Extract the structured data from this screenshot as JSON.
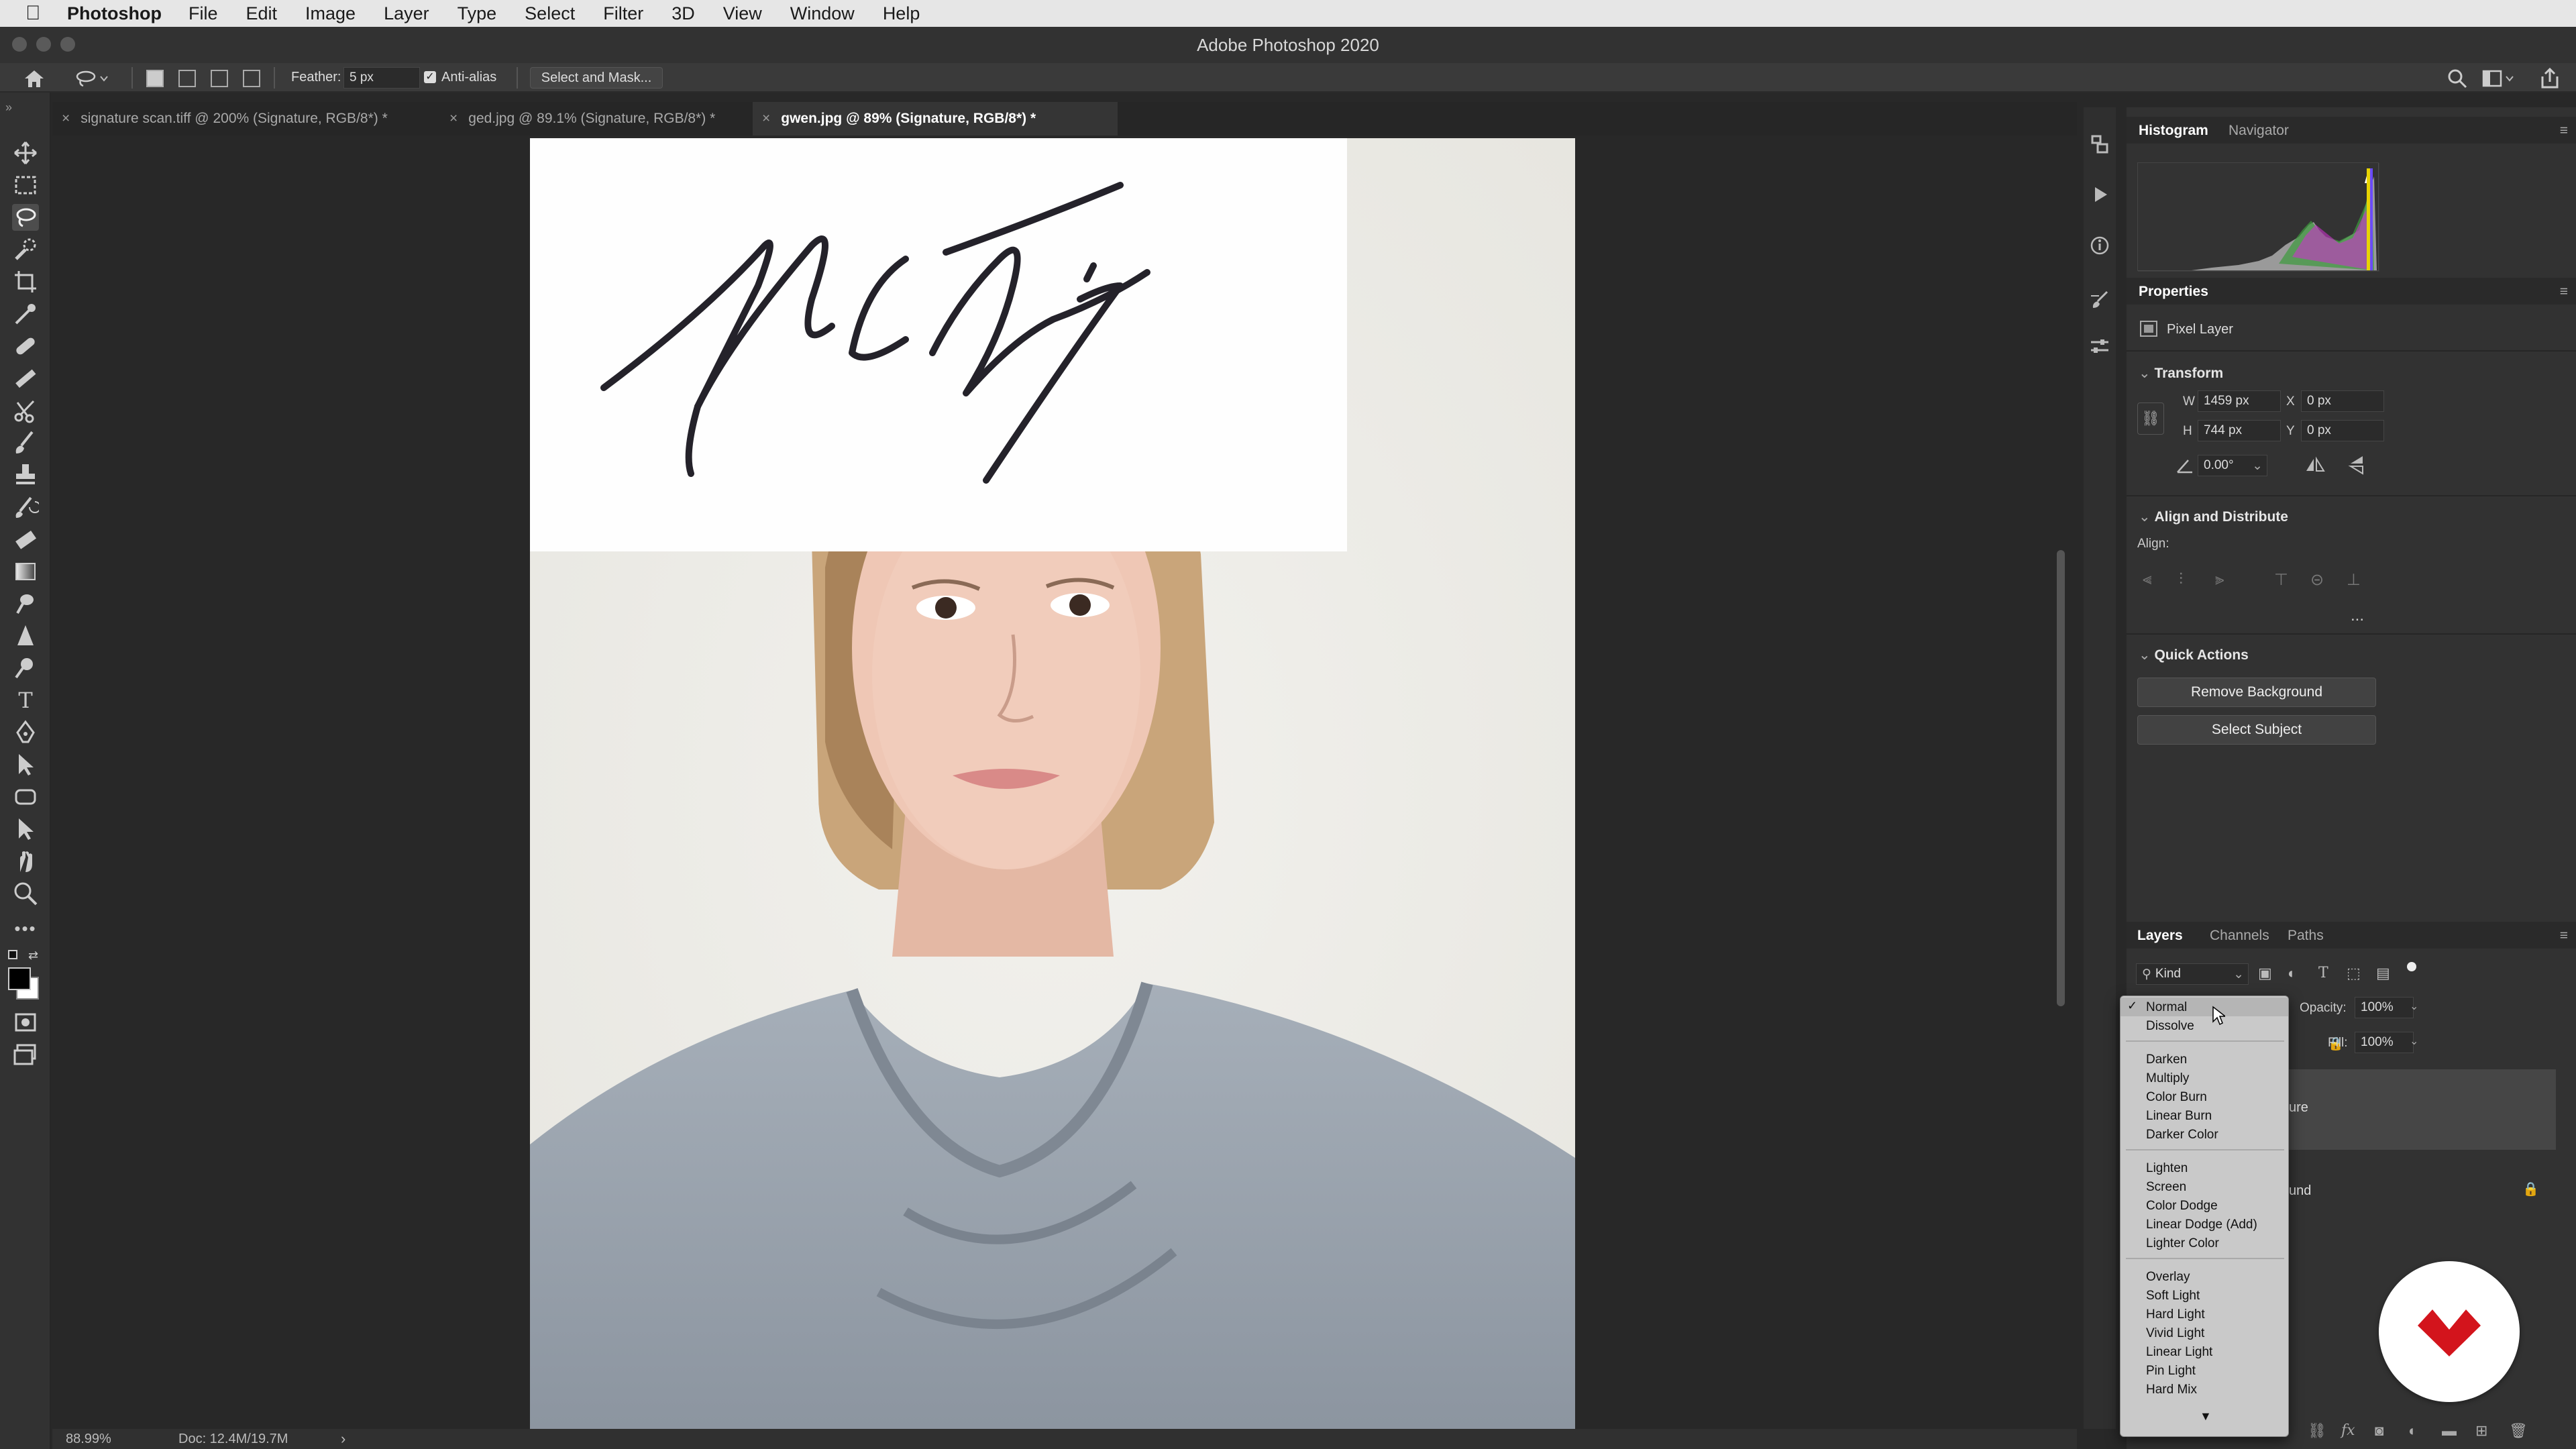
{
  "menubar": {
    "app_name": "Photoshop",
    "menus": [
      "File",
      "Edit",
      "Image",
      "Layer",
      "Type",
      "Select",
      "Filter",
      "3D",
      "View",
      "Window",
      "Help"
    ]
  },
  "window": {
    "title": "Adobe Photoshop 2020"
  },
  "options": {
    "feather_label": "Feather:",
    "feather_value": "5 px",
    "antialias_label": "Anti-alias",
    "select_mask_label": "Select and Mask..."
  },
  "tabs": [
    {
      "label": "signature scan.tiff @ 200% (Signature, RGB/8*) *",
      "active": false
    },
    {
      "label": "ged.jpg @ 89.1% (Signature, RGB/8*) *",
      "active": false
    },
    {
      "label": "gwen.jpg @ 89% (Signature, RGB/8*) *",
      "active": true
    }
  ],
  "status": {
    "zoom": "88.99%",
    "doc": "Doc: 12.4M/19.7M"
  },
  "histogram_panel": {
    "tabs": [
      "Histogram",
      "Navigator"
    ]
  },
  "properties_panel": {
    "title": "Properties",
    "layer_type": "Pixel Layer",
    "transform_title": "Transform",
    "w_label": "W",
    "w_value": "1459 px",
    "h_label": "H",
    "h_value": "744 px",
    "x_label": "X",
    "x_value": "0 px",
    "y_label": "Y",
    "y_value": "0 px",
    "angle_value": "0.00°",
    "align_title": "Align and Distribute",
    "align_label": "Align:",
    "more": "...",
    "quick_actions_title": "Quick Actions",
    "remove_bg": "Remove Background",
    "select_subject": "Select Subject"
  },
  "layers_panel": {
    "tabs": [
      "Layers",
      "Channels",
      "Paths"
    ],
    "filter_label": "Kind",
    "opacity_label": "Opacity:",
    "opacity_value": "100%",
    "fill_label": "Fill:",
    "fill_value": "100%",
    "layer1_partial": "ure",
    "layer2_partial": "und"
  },
  "blend_menu": {
    "checked": "Normal",
    "groups": [
      [
        "Normal",
        "Dissolve"
      ],
      [
        "Darken",
        "Multiply",
        "Color Burn",
        "Linear Burn",
        "Darker Color"
      ],
      [
        "Lighten",
        "Screen",
        "Color Dodge",
        "Linear Dodge (Add)",
        "Lighter Color"
      ],
      [
        "Overlay",
        "Soft Light",
        "Hard Light",
        "Vivid Light",
        "Linear Light",
        "Pin Light",
        "Hard Mix"
      ]
    ]
  },
  "colors": {
    "accent_badge": "#d3141c",
    "ui_dark": "#323232"
  }
}
